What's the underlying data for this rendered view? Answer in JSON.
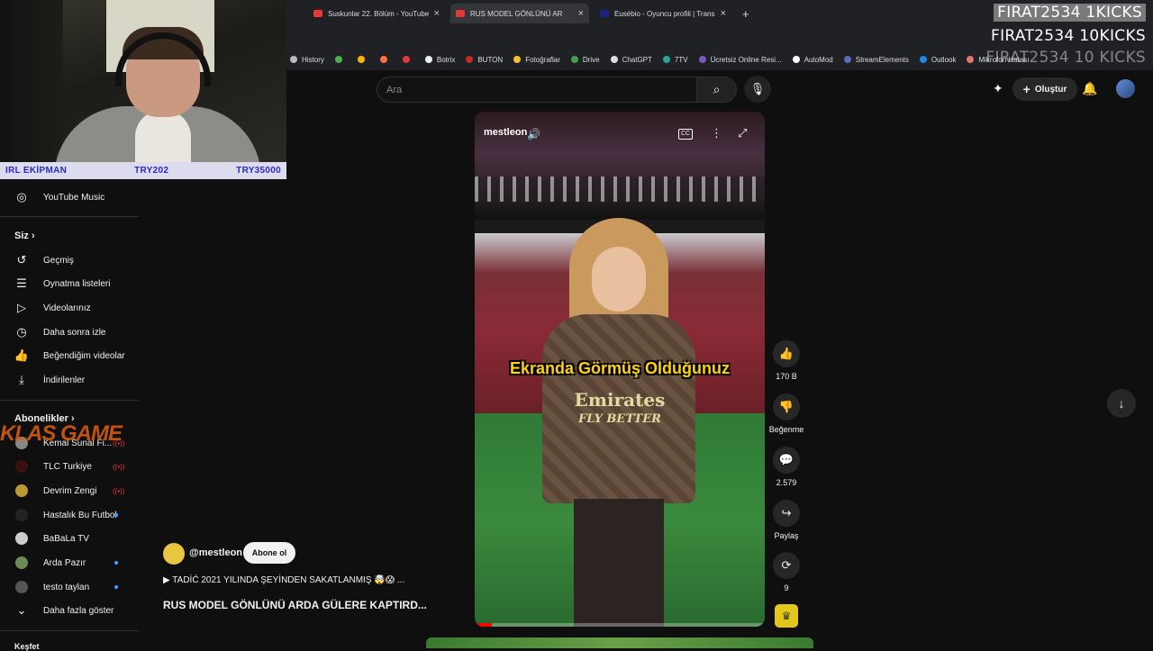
{
  "webcam_bar": {
    "left": "IRL EKİPMAN",
    "mid": "TRY202",
    "right": "TRY35000"
  },
  "tabs": [
    {
      "label": "Suskunlar 22. Bölüm - YouTube",
      "fav_color": "#e53935"
    },
    {
      "label": "RUS MODEL GÖNLÜNÜ AR",
      "fav_color": "#e53935"
    },
    {
      "label": "Eusébio - Oyuncu profili | Trans",
      "fav_color": "#1a237e"
    }
  ],
  "tab_plus": "+",
  "tab_close": "×",
  "bookmarks": [
    {
      "label": "History",
      "icon": "history-icon"
    },
    {
      "label": "",
      "icon": "green-icon"
    },
    {
      "label": "",
      "icon": "yellow-icon"
    },
    {
      "label": "",
      "icon": "orange-icon"
    },
    {
      "label": "",
      "icon": "red-icon"
    },
    {
      "label": "Botrix",
      "icon": "botrix-icon"
    },
    {
      "label": "BUTON",
      "icon": "buton-icon"
    },
    {
      "label": "Fotoğraflar",
      "icon": "photos-icon"
    },
    {
      "label": "Drive",
      "icon": "drive-icon"
    },
    {
      "label": "ChatGPT",
      "icon": "chatgpt-icon"
    },
    {
      "label": "7TV",
      "icon": "7tv-icon"
    },
    {
      "label": "Ücretsiz Online Resi...",
      "icon": "rp-icon"
    },
    {
      "label": "AutoMod",
      "icon": "automod-icon"
    },
    {
      "label": "StreamElements",
      "icon": "streamelements-icon"
    },
    {
      "label": "Outlook",
      "icon": "outlook-icon"
    },
    {
      "label": "Mikrofon Hatası",
      "icon": "mic-icon"
    }
  ],
  "kicks": [
    "FIRAT2534 1KICKS",
    "FIRAT2534 10KICKS",
    "FIRAT2534 10 KICKS"
  ],
  "header": {
    "search_placeholder": "Ara",
    "create_label": "Oluştur"
  },
  "sidebar": {
    "music": "YouTube Music",
    "you_heading": "Siz",
    "you_items": [
      "Geçmiş",
      "Oynatma listeleri",
      "Videolarınız",
      "Daha sonra izle",
      "Beğendiğim videolar",
      "İndirilenler"
    ],
    "subs_heading": "Abonelikler",
    "channels": [
      {
        "name": "Kemal Sunal Fi...",
        "badge": "live"
      },
      {
        "name": "TLC Turkiye",
        "badge": "live"
      },
      {
        "name": "Devrim Zengi",
        "badge": "live"
      },
      {
        "name": "Hastalık Bu Futbol",
        "badge": "dot"
      },
      {
        "name": "BaBaLa TV",
        "badge": ""
      },
      {
        "name": "Arda Pazır",
        "badge": "dot"
      },
      {
        "name": "testo taylan",
        "badge": "dot"
      }
    ],
    "show_more": "Daha fazla göster",
    "explore": "Keşfet"
  },
  "overlay_logo": "KLAS GAME",
  "short": {
    "channel_tag": "mestleon",
    "caption": "Ekranda Görmüş Olduğunuz",
    "jersey_sponsor": "Emirates",
    "jersey_tagline": "FLY BETTER",
    "cc": "CC",
    "progress": 0.06
  },
  "actions": {
    "likes": "170 B",
    "dislike": "Beğenme",
    "comments": "2.579",
    "share": "Paylaş",
    "remix": "9"
  },
  "channel": {
    "handle": "@mestleon",
    "subscribe": "Abone ol"
  },
  "description": "▶ TADİĆ 2021 YILINDA ŞEYİNDEN SAKATLANMIŞ 🤯😱 ...",
  "video_title": "RUS MODEL GÖNLÜNÜ ARDA GÜLERE KAPTIRD..."
}
